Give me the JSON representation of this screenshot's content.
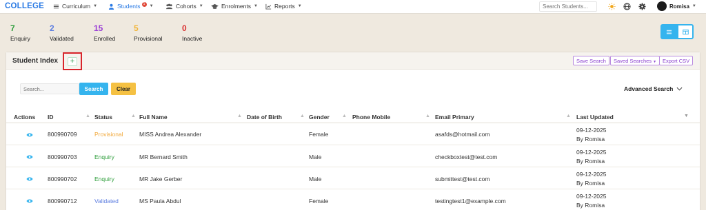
{
  "nav": {
    "brand": "COLLEGE",
    "items": [
      {
        "label": "Curriculum"
      },
      {
        "label": "Students",
        "badge": "1"
      },
      {
        "label": "Cohorts"
      },
      {
        "label": "Enrolments"
      },
      {
        "label": "Reports"
      }
    ],
    "search_placeholder": "Search Students...",
    "user": "Romisa"
  },
  "stats": [
    {
      "value": "7",
      "label": "Enquiry",
      "color": "#2e9e3b"
    },
    {
      "value": "2",
      "label": "Validated",
      "color": "#5c7de0"
    },
    {
      "value": "15",
      "label": "Enrolled",
      "color": "#9b3fd6"
    },
    {
      "value": "5",
      "label": "Provisional",
      "color": "#f1b53a"
    },
    {
      "value": "0",
      "label": "Inactive",
      "color": "#d93030"
    }
  ],
  "card": {
    "title": "Student Index",
    "add_label": "+",
    "buttons": {
      "save_search": "Save Search",
      "saved_searches": "Saved Searches",
      "export_csv": "Export CSV"
    },
    "search_placeholder": "Search...",
    "search_label": "Search",
    "clear_label": "Clear",
    "advanced_search": "Advanced Search"
  },
  "table": {
    "headers": [
      "Actions",
      "ID",
      "Status",
      "Full Name",
      "Date of Birth",
      "Gender",
      "Phone Mobile",
      "Email Primary",
      "Last Updated"
    ],
    "rows": [
      {
        "id": "800990709",
        "status": "Provisional",
        "status_color": "#f1a83a",
        "name": "MISS Andrea Alexander",
        "dob": "",
        "gender": "Female",
        "phone": "",
        "email": "asafds@hotmail.com",
        "updated": "09-12-2025",
        "by": "By Romisa"
      },
      {
        "id": "800990703",
        "status": "Enquiry",
        "status_color": "#2e9e3b",
        "name": "MR Bernard Smith",
        "dob": "",
        "gender": "Male",
        "phone": "",
        "email": "checkboxtest@test.com",
        "updated": "09-12-2025",
        "by": "By Romisa"
      },
      {
        "id": "800990702",
        "status": "Enquiry",
        "status_color": "#2e9e3b",
        "name": "MR Jake Gerber",
        "dob": "",
        "gender": "Male",
        "phone": "",
        "email": "submittest@test.com",
        "updated": "09-12-2025",
        "by": "By Romisa"
      },
      {
        "id": "800990712",
        "status": "Validated",
        "status_color": "#5c7de0",
        "name": "MS Paula Abdul",
        "dob": "",
        "gender": "Female",
        "phone": "",
        "email": "testingtest1@example.com",
        "updated": "09-12-2025",
        "by": "By Romisa"
      }
    ]
  },
  "colors": {
    "accent": "#35b4ee",
    "brand": "#2a7ae4",
    "clear": "#f5c143",
    "highlight": "#d9252b"
  }
}
